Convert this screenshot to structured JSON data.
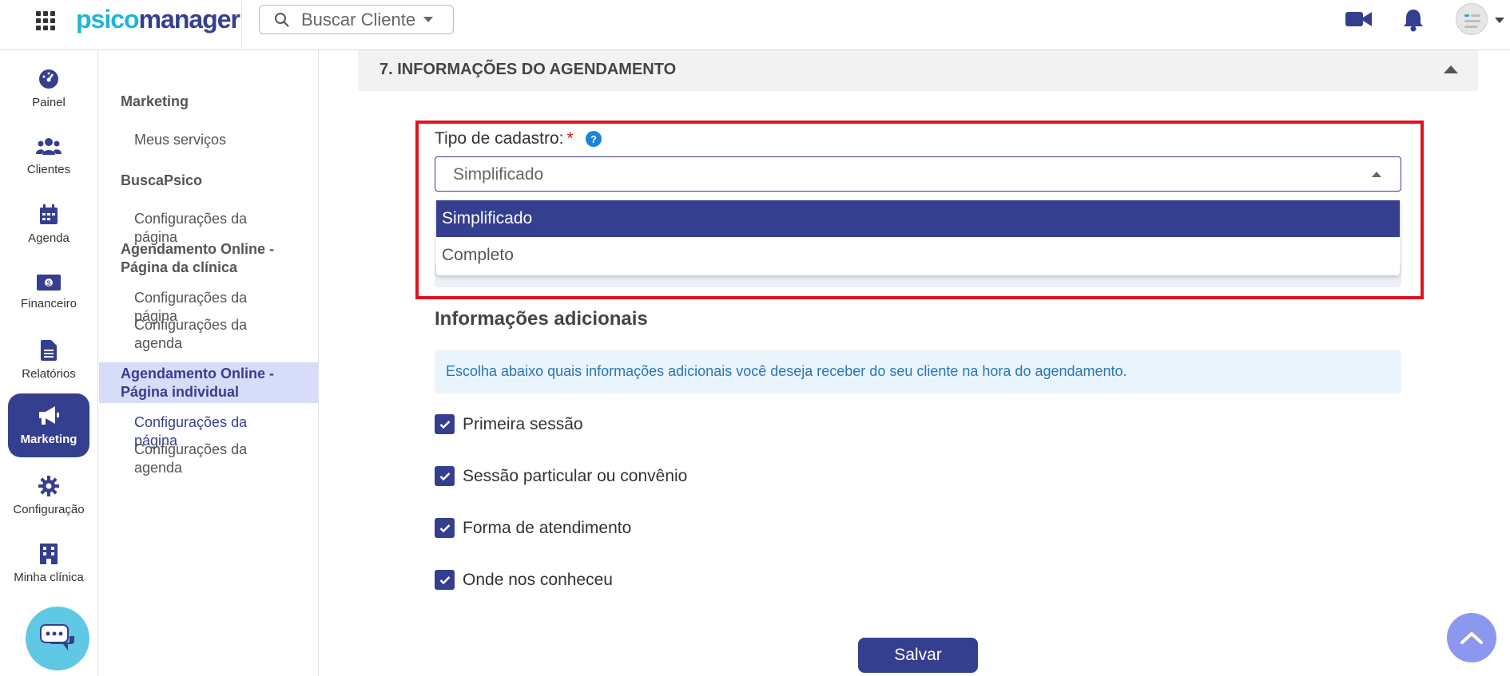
{
  "header": {
    "logo_primary": "psico",
    "logo_secondary": "manager",
    "search_placeholder": "Buscar Cliente"
  },
  "rail": {
    "items": [
      {
        "label": "Painel",
        "icon": "dashboard-icon"
      },
      {
        "label": "Clientes",
        "icon": "users-icon"
      },
      {
        "label": "Agenda",
        "icon": "calendar-icon"
      },
      {
        "label": "Financeiro",
        "icon": "money-icon"
      },
      {
        "label": "Relatórios",
        "icon": "file-icon"
      },
      {
        "label": "Marketing",
        "icon": "megaphone-icon",
        "active": true
      },
      {
        "label": "Configuração",
        "icon": "gear-icon"
      },
      {
        "label": "Minha clínica",
        "icon": "building-icon"
      }
    ]
  },
  "submenu": {
    "group_marketing": "Marketing",
    "link_meus_servicos": "Meus serviços",
    "group_buscapsico": "BuscaPsico",
    "link_buscapsico_config": "Configurações da página",
    "group_clinica": "Agendamento Online - Página da clínica",
    "link_clinica_pagina": "Configurações da página",
    "link_clinica_agenda": "Configurações da agenda",
    "group_individual": "Agendamento Online - Página individual",
    "link_individual_pagina": "Configurações da página",
    "link_individual_agenda": "Configurações da agenda"
  },
  "section": {
    "title": "7. INFORMAÇÕES DO AGENDAMENTO"
  },
  "form": {
    "tipo_label": "Tipo de cadastro:",
    "required_mark": "*",
    "help_mark": "?",
    "select_value": "Simplificado",
    "options": [
      "Simplificado",
      "Completo"
    ],
    "selected_option": "Simplificado"
  },
  "additional": {
    "title": "Informações adicionais",
    "alert": "Escolha abaixo quais informações adicionais você deseja receber do seu cliente na hora do agendamento.",
    "checkboxes": [
      {
        "label": "Primeira sessão",
        "checked": true
      },
      {
        "label": "Sessão particular ou convênio",
        "checked": true
      },
      {
        "label": "Forma de atendimento",
        "checked": true
      },
      {
        "label": "Onde nos conheceu",
        "checked": true
      }
    ]
  },
  "actions": {
    "save_label": "Salvar"
  },
  "colors": {
    "primary": "#353f8f",
    "accent": "#1fb5d6",
    "highlight": "#e0141e",
    "submenu_active_bg": "#d7dcf8"
  }
}
